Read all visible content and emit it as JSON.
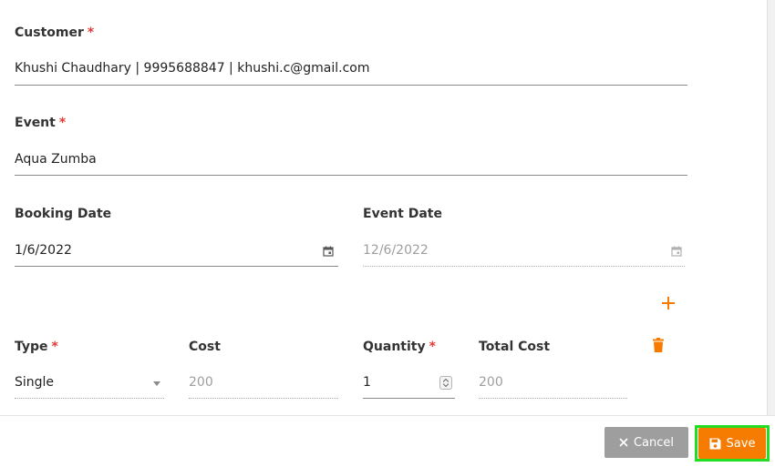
{
  "form": {
    "customer": {
      "label": "Customer",
      "required_mark": "*",
      "value": "Khushi Chaudhary | 9995688847 | khushi.c@gmail.com"
    },
    "event": {
      "label": "Event",
      "required_mark": "*",
      "value": "Aqua Zumba"
    },
    "booking_date": {
      "label": "Booking Date",
      "value": "1/6/2022"
    },
    "event_date": {
      "label": "Event Date",
      "value": "12/6/2022"
    },
    "line_item": {
      "type": {
        "label": "Type",
        "required_mark": "*",
        "value": "Single"
      },
      "cost": {
        "label": "Cost",
        "value": "200"
      },
      "quantity": {
        "label": "Quantity",
        "required_mark": "*",
        "value": "1"
      },
      "total_cost": {
        "label": "Total Cost",
        "value": "200"
      }
    }
  },
  "footer": {
    "cancel_label": "Cancel",
    "save_label": "Save"
  },
  "icons": {
    "add": "plus-icon",
    "delete": "trash-icon",
    "calendar": "calendar-icon",
    "dropdown": "caret-down-icon",
    "cancel": "close-icon",
    "save": "floppy-disk-icon"
  },
  "colors": {
    "accent": "#f57c00",
    "required": "#e53935",
    "cancel": "#9e9e9e",
    "focus_outline": "#22dd22"
  }
}
